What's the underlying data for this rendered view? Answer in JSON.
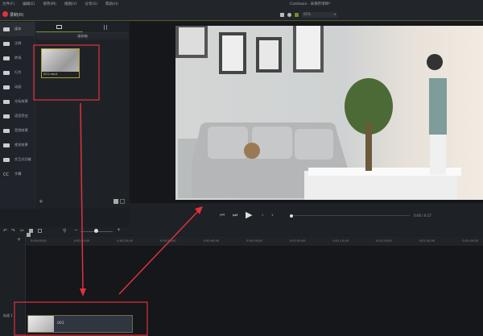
{
  "menu": [
    "文件(F)",
    "编辑(E)",
    "修改(M)",
    "视图(V)",
    "分享(S)",
    "帮助(H)"
  ],
  "window_title": "Camtasia - 未保存项目*",
  "record_label": "录制(R)",
  "zoom_level": "65%",
  "sidebar": [
    "媒体",
    "注释",
    "转场",
    "行为",
    "动画",
    "光标效果",
    "语音旁白",
    "音频效果",
    "视觉效果",
    "交互式功能",
    "字幕"
  ],
  "bin": {
    "header": "媒体箱",
    "clip_name": "001.mp4"
  },
  "player": {
    "time": "0:00 / 0:17"
  },
  "timeline": {
    "ticks": [
      "0:00:00;00",
      "0:00:10;00",
      "0:00:20;00",
      "0:00:30;00",
      "0:00:40;00",
      "0:00:50;00",
      "0:01:00;00",
      "0:01:10;00",
      "0:01:20;00",
      "0:01:30;00",
      "0:01:40;00"
    ],
    "track_label": "轨道 1",
    "clip_label": "001"
  },
  "colors": {
    "accent": "#7a8a30",
    "annotation": "#e0323c"
  }
}
